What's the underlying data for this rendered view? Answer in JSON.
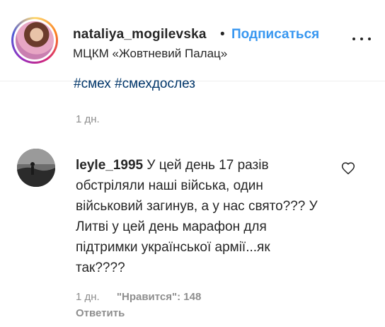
{
  "post": {
    "username": "nataliya_mogilevska",
    "separator": "•",
    "follow_label": "Подписаться",
    "location": "МЦКМ «Жовтневий Палац»",
    "hashtags": "#смех #смехдослез",
    "time": "1 дн."
  },
  "comment": {
    "username": "leyle_1995",
    "text": "У цей день 17 разів обстріляли наші війська, один військовий загинув, а у нас свято??? У Литві у цей день марафон для підтримки української армії...як так????",
    "time": "1 дн.",
    "likes": "\"Нравится\": 148",
    "reply_label": "Ответить"
  },
  "icons": {
    "more": "more-options-icon",
    "like": "heart-icon"
  },
  "colors": {
    "link": "#3897f0",
    "hashtag": "#003569",
    "muted": "#8e8e8e",
    "text": "#262626"
  }
}
